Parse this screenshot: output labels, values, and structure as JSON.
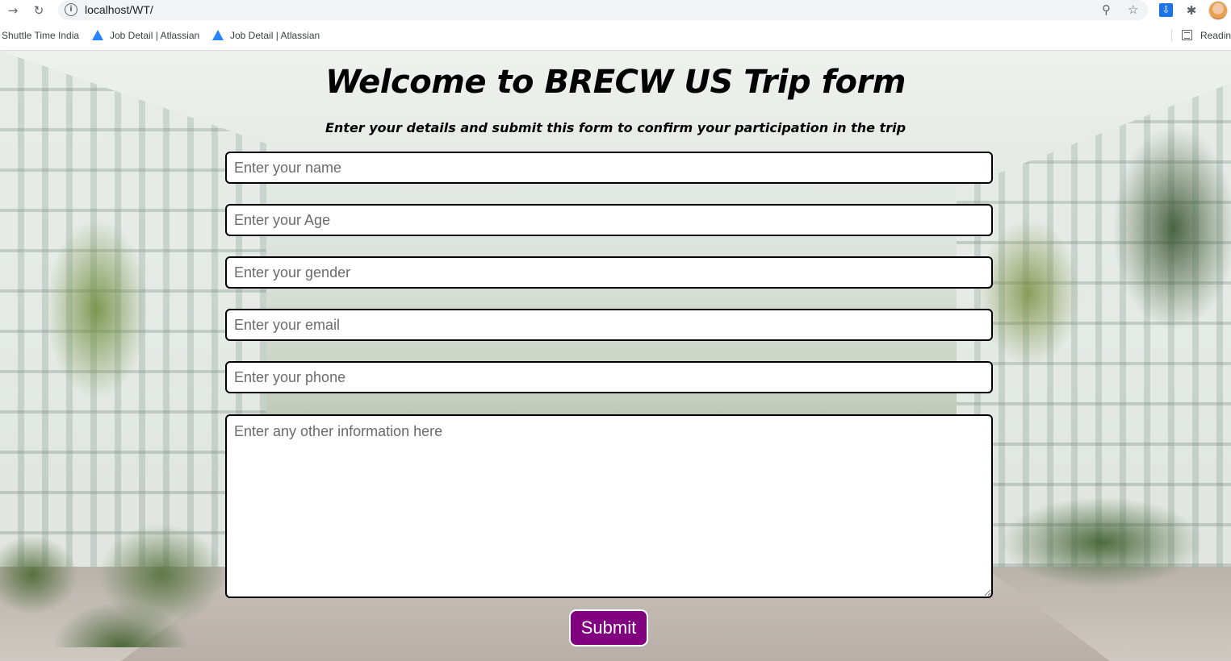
{
  "browser": {
    "url": "localhost/WT/",
    "bookmarks": [
      {
        "label": "Shuttle Time India"
      },
      {
        "label": "Job Detail | Atlassian"
      },
      {
        "label": "Job Detail | Atlassian"
      }
    ],
    "reading_list_label": "Reading"
  },
  "form": {
    "title": "Welcome to BRECW US Trip form",
    "subtitle": "Enter your details and submit this form to confirm your participation in the trip",
    "fields": {
      "name": {
        "placeholder": "Enter your name",
        "value": ""
      },
      "age": {
        "placeholder": "Enter your Age",
        "value": ""
      },
      "gender": {
        "placeholder": "Enter your gender",
        "value": ""
      },
      "email": {
        "placeholder": "Enter your email",
        "value": ""
      },
      "phone": {
        "placeholder": "Enter your phone",
        "value": ""
      },
      "other": {
        "placeholder": "Enter any other information here",
        "value": ""
      }
    },
    "submit_label": "Submit"
  },
  "colors": {
    "submit_bg": "#800080",
    "field_border": "#000000",
    "bookmark_logo": "#2684ff"
  },
  "icons": [
    "forward-icon",
    "reload-icon",
    "info-icon",
    "zoom-icon",
    "star-icon",
    "download-extension-icon",
    "extensions-icon",
    "profile-avatar",
    "atlassian-logo-icon",
    "reading-list-icon"
  ]
}
